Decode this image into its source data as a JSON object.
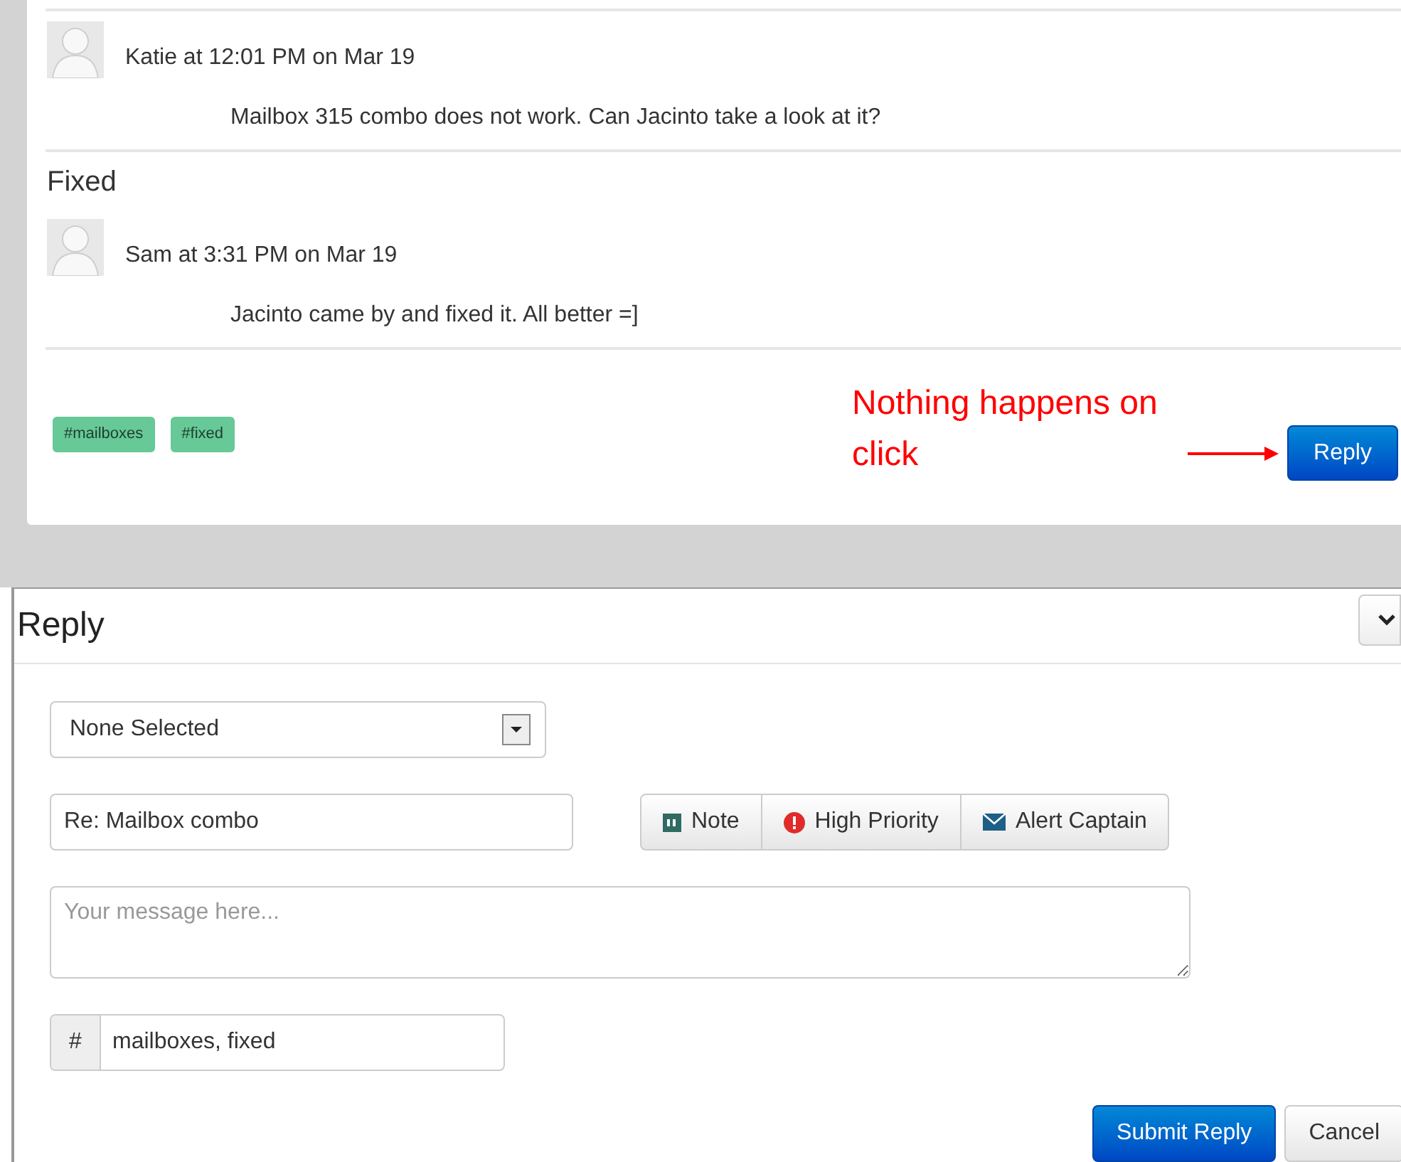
{
  "thread": [
    {
      "kind": "comment",
      "author_line": "Katie at 12:01 PM on Mar 19",
      "message": "Mailbox 315 combo does not work. Can Jacinto take a look at it?"
    },
    {
      "kind": "status",
      "text": "Fixed"
    },
    {
      "kind": "comment",
      "author_line": "Sam at 3:31 PM on Mar 19",
      "message": "Jacinto came by and fixed it. All better =]"
    }
  ],
  "tags": [
    "#mailboxes",
    "#fixed"
  ],
  "annotation": "Nothing happens on click",
  "reply_button": "Reply",
  "reply_panel": {
    "title": "Reply",
    "category_select": {
      "value": "None Selected"
    },
    "subject_field": {
      "value": "Re: Mailbox combo"
    },
    "flag_buttons": [
      {
        "kind": "note",
        "label": "Note"
      },
      {
        "kind": "priority",
        "label": "High Priority"
      },
      {
        "kind": "alert",
        "label": "Alert Captain"
      }
    ],
    "message_field": {
      "placeholder": "Your message here..."
    },
    "tags_field": {
      "prefix": "#",
      "value": "mailboxes, fixed"
    },
    "buttons": [
      {
        "kind": "primary",
        "label": "Submit Reply"
      },
      {
        "kind": "default",
        "label": "Cancel"
      }
    ]
  }
}
